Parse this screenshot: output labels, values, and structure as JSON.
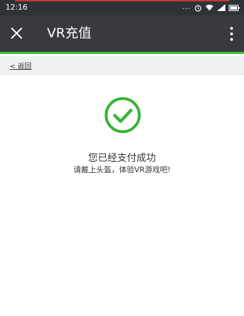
{
  "status_bar": {
    "time": "12:16",
    "dots": "...",
    "icons": [
      "alarm-icon",
      "wifi-icon",
      "signal-icon",
      "battery-icon"
    ]
  },
  "app_bar": {
    "title": "VR充值",
    "close_icon": "close-icon",
    "more_icon": "more-vertical-icon",
    "accent_color": "#35c335"
  },
  "back_link": {
    "label": "< 返回"
  },
  "result": {
    "icon": "check-circle-icon",
    "icon_color": "#35b535",
    "message": "您已经支付成功",
    "hint": "请戴上头盔，体验VR游戏吧!"
  }
}
